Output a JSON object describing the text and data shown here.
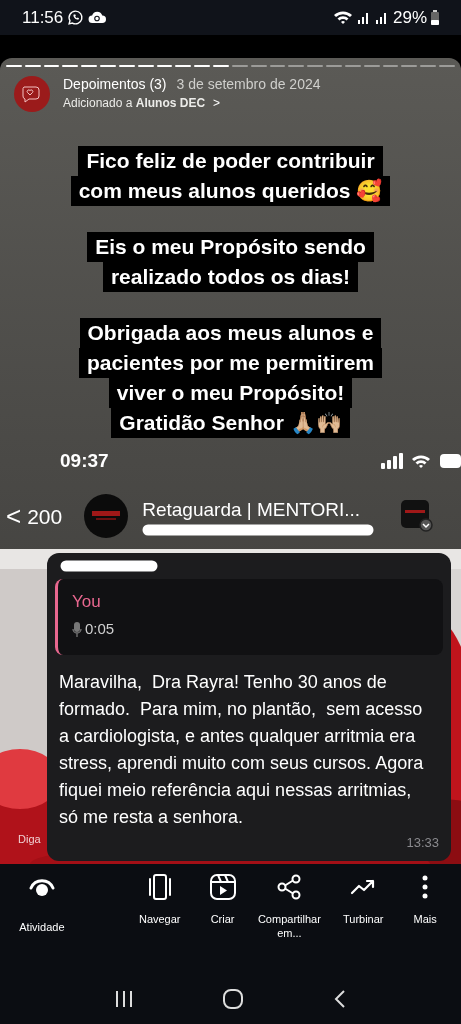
{
  "status_bar": {
    "time": "11:56",
    "battery": "29%"
  },
  "story": {
    "progress": [
      {
        "viewed": true
      },
      {
        "viewed": true
      },
      {
        "viewed": true
      },
      {
        "viewed": true
      },
      {
        "viewed": true
      },
      {
        "viewed": true
      },
      {
        "viewed": true
      },
      {
        "viewed": true
      },
      {
        "viewed": true
      },
      {
        "viewed": true
      },
      {
        "viewed": true
      },
      {
        "viewed": true
      },
      {
        "viewed": false
      },
      {
        "viewed": false
      },
      {
        "viewed": false
      },
      {
        "viewed": false
      },
      {
        "viewed": false
      },
      {
        "viewed": false
      },
      {
        "viewed": false
      },
      {
        "viewed": false
      },
      {
        "viewed": false
      },
      {
        "viewed": false
      },
      {
        "viewed": false
      },
      {
        "viewed": false
      }
    ],
    "title": "Depoimentos (3)",
    "date": "3 de setembro de 2024",
    "added_to": "Adicionado a **Alunos DEC**",
    "chevron": ">",
    "captions": [
      {
        "lines": [
          "Fico feliz de poder contribuir",
          "com meus alunos queridos 🥰"
        ]
      },
      {
        "lines": [
          "Eis o meu Propósito sendo",
          "realizado todos os dias!"
        ]
      },
      {
        "lines": [
          "Obrigada aos meus alunos e",
          "pacientes por me permitirem",
          "viver o meu Propósito!",
          "Gratidão Senhor 🙏🏼🙌🏼"
        ]
      }
    ]
  },
  "embedded_screenshot": {
    "time": "09:37",
    "back": "<",
    "unread_count": "200",
    "chat_title": "Retaguarda | MENTORI...",
    "message": {
      "reply": {
        "author": "You",
        "duration": "0:05"
      },
      "text": "Maravilha,  Dra Rayra! Tenho 30 anos de formado.  Para mim, no plantão,  sem acesso a cardiologista, e antes qualquer arritmia era stress, aprendi muito com seus cursos. Agora fiquei meio referência aqui nessas arritmias, só me resta a senhora.",
      "time": "13:33"
    },
    "input_hint": "Diga"
  },
  "toolbar": [
    {
      "kind": "activity",
      "label": "Atividade"
    },
    {
      "kind": "browse",
      "label": "Navegar"
    },
    {
      "kind": "create",
      "label": "Criar"
    },
    {
      "kind": "share",
      "label": "Compartilhar em..."
    },
    {
      "kind": "boost",
      "label": "Turbinar"
    },
    {
      "kind": "more",
      "label": "Mais"
    }
  ]
}
